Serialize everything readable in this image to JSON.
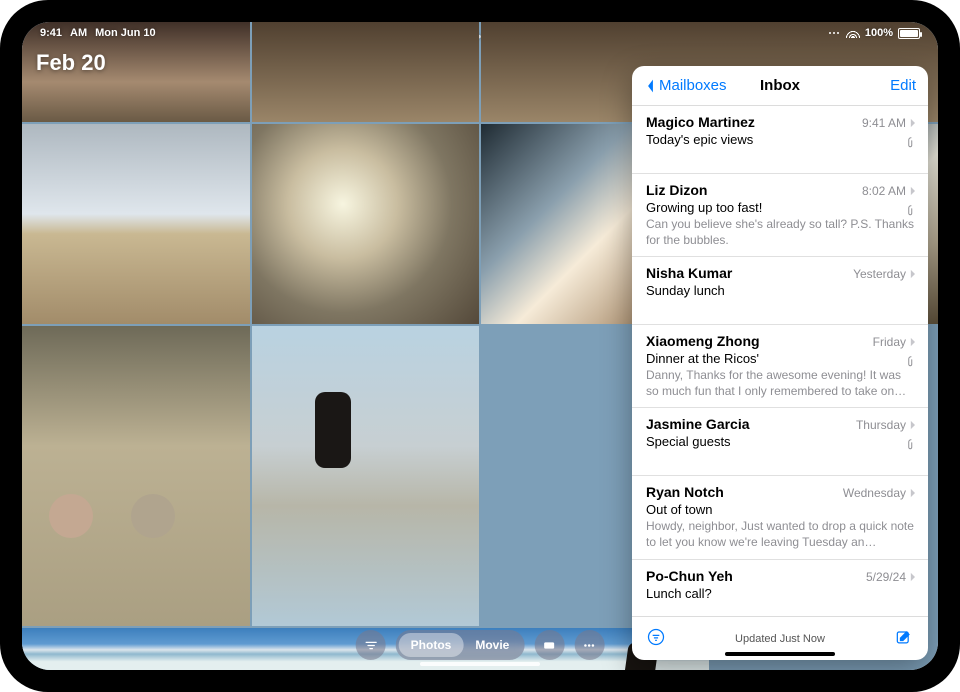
{
  "status": {
    "time": "9:41",
    "am": "AM",
    "date": "Mon Jun 10",
    "battery": "100%"
  },
  "photos": {
    "date_title": "Feb 20",
    "segments": {
      "photos": "Photos",
      "movie": "Movie"
    }
  },
  "mail": {
    "back_label": "Mailboxes",
    "title": "Inbox",
    "edit": "Edit",
    "status_text": "Updated Just Now",
    "messages": [
      {
        "sender": "Magico Martinez",
        "time": "9:41 AM",
        "subject": "Today's epic views",
        "preview": "",
        "attach": true
      },
      {
        "sender": "Liz Dizon",
        "time": "8:02 AM",
        "subject": "Growing up too fast!",
        "preview": "Can you believe she's already so tall? P.S. Thanks for the bubbles.",
        "attach": true
      },
      {
        "sender": "Nisha Kumar",
        "time": "Yesterday",
        "subject": "Sunday lunch",
        "preview": "",
        "attach": false
      },
      {
        "sender": "Xiaomeng Zhong",
        "time": "Friday",
        "subject": "Dinner at the Ricos'",
        "preview": "Danny, Thanks for the awesome evening! It was so much fun that I only remembered to take on…",
        "attach": true
      },
      {
        "sender": "Jasmine Garcia",
        "time": "Thursday",
        "subject": "Special guests",
        "preview": "",
        "attach": true
      },
      {
        "sender": "Ryan Notch",
        "time": "Wednesday",
        "subject": "Out of town",
        "preview": "Howdy, neighbor, Just wanted to drop a quick note to let you know we're leaving Tuesday an…",
        "attach": false
      },
      {
        "sender": "Po-Chun Yeh",
        "time": "5/29/24",
        "subject": "Lunch call?",
        "preview": "",
        "attach": false
      }
    ]
  }
}
